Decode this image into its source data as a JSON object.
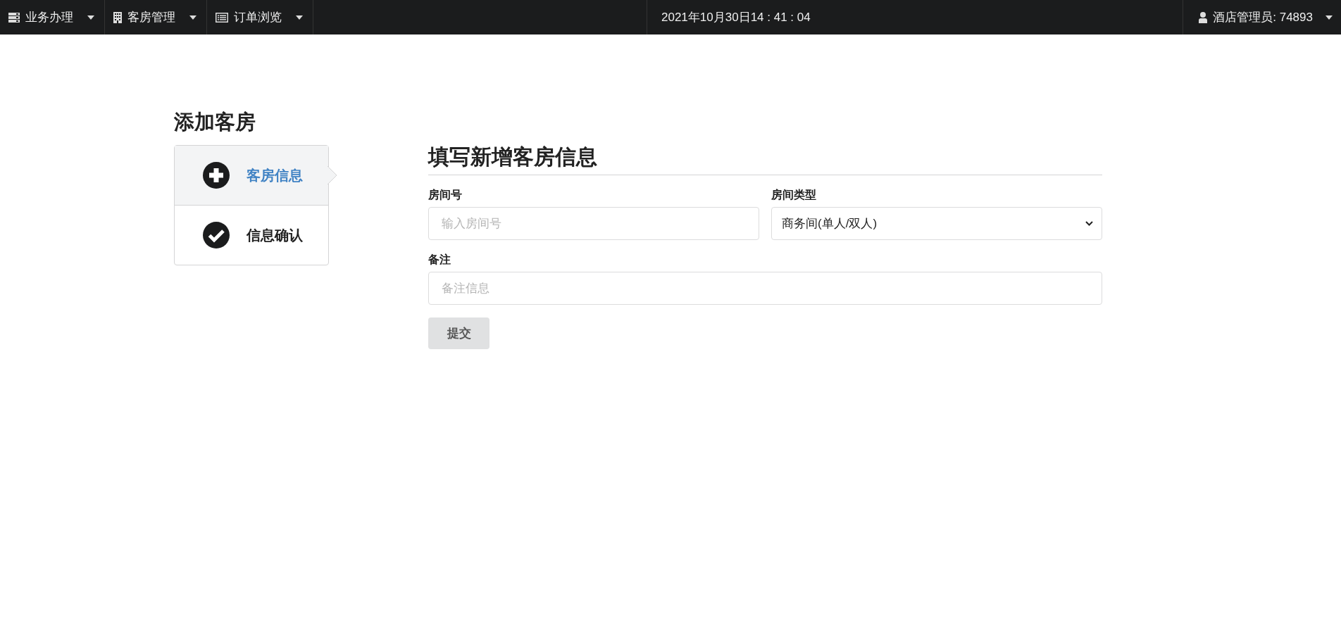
{
  "navbar": {
    "menus": [
      {
        "label": "业务办理",
        "kind": "server"
      },
      {
        "label": "客房管理",
        "kind": "building"
      },
      {
        "label": "订单浏览",
        "kind": "list"
      }
    ],
    "clock": "2021年10月30日14 : 41 : 04",
    "user": "酒店管理员: 74893"
  },
  "page_title": "添加客房",
  "steps": [
    {
      "label": "客房信息",
      "kind": "plus",
      "selected": true
    },
    {
      "label": "信息确认",
      "kind": "check",
      "selected": false
    }
  ],
  "form": {
    "heading": "填写新增客房信息",
    "rows": [
      [
        {
          "kind": "text",
          "label": "房间号",
          "placeholder": "输入房间号"
        },
        {
          "kind": "select",
          "label": "房间类型",
          "value": "商务间(单人/双人)"
        }
      ],
      [
        {
          "kind": "text",
          "label": "备注",
          "placeholder": "备注信息"
        }
      ]
    ],
    "submit": "提交"
  }
}
